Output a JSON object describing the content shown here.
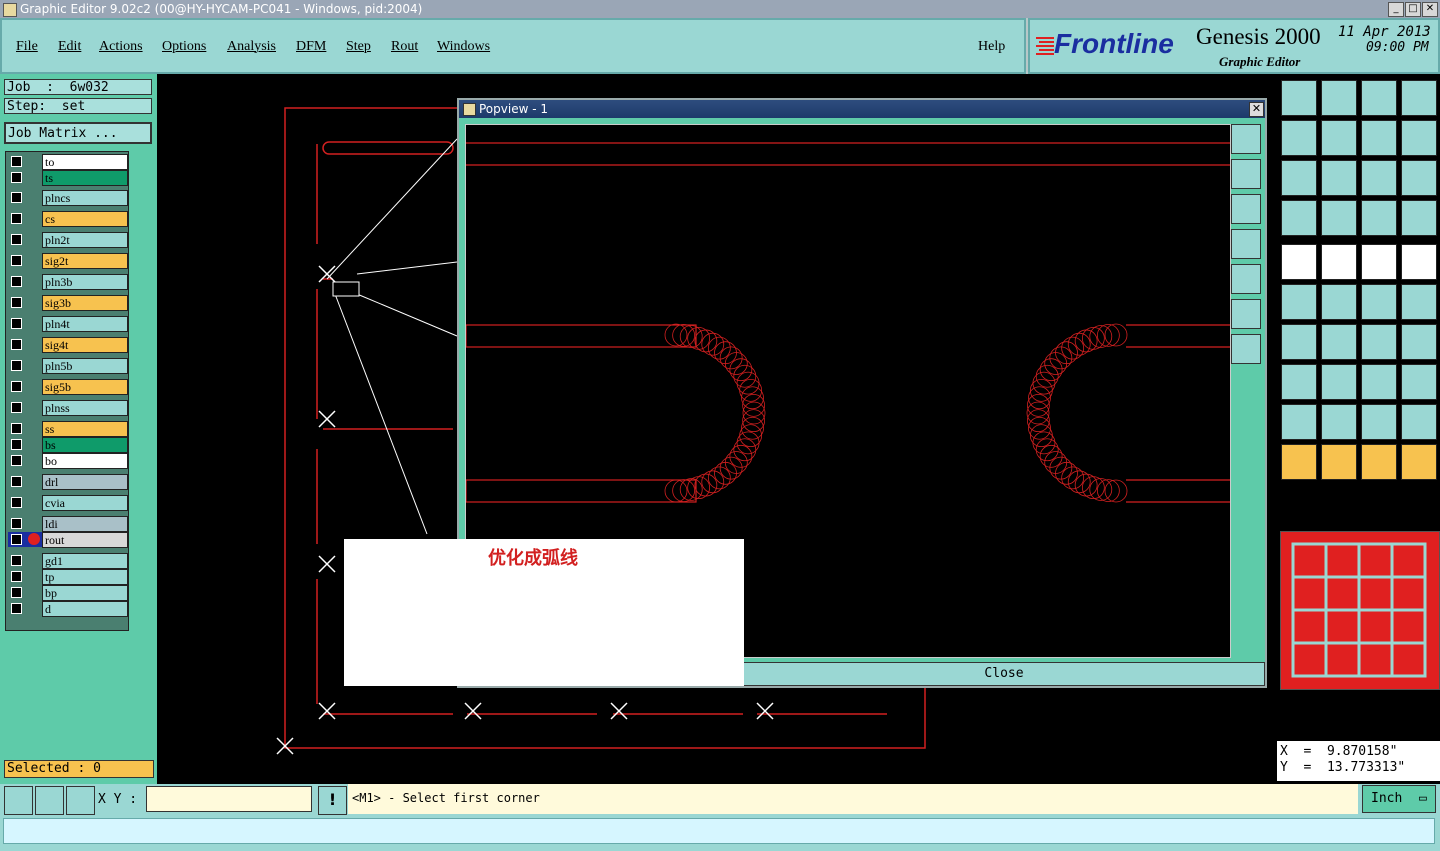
{
  "window": {
    "title": "Graphic Editor 9.02c2 (00@HY-HYCAM-PC041 - Windows, pid:2004)"
  },
  "menu": [
    "File",
    "Edit",
    "Actions",
    "Options",
    "Analysis",
    "DFM",
    "Step",
    "Rout",
    "Windows"
  ],
  "help": "Help",
  "brand": {
    "logo": "Frontline",
    "product": "Genesis 2000",
    "subtitle": "Graphic Editor",
    "date": "11 Apr 2013",
    "time": "09:00 PM"
  },
  "job": {
    "job_label": "Job  :  6w032",
    "step_label": "Step:  set",
    "matrix_button": "Job Matrix ..."
  },
  "layers": [
    {
      "name": "to",
      "color": "#ffffff"
    },
    {
      "name": "ts",
      "color": "#0f9b6a"
    },
    {
      "name": "plncs",
      "color": "#9ad7d3"
    },
    {
      "name": "cs",
      "color": "#f7c24f"
    },
    {
      "name": "pln2t",
      "color": "#9ad7d3"
    },
    {
      "name": "sig2t",
      "color": "#f7c24f"
    },
    {
      "name": "pln3b",
      "color": "#9ad7d3"
    },
    {
      "name": "sig3b",
      "color": "#f7c24f"
    },
    {
      "name": "pln4t",
      "color": "#9ad7d3"
    },
    {
      "name": "sig4t",
      "color": "#f7c24f"
    },
    {
      "name": "pln5b",
      "color": "#9ad7d3"
    },
    {
      "name": "sig5b",
      "color": "#f7c24f"
    },
    {
      "name": "plnss",
      "color": "#9ad7d3"
    },
    {
      "name": "ss",
      "color": "#f7c24f"
    },
    {
      "name": "bs",
      "color": "#0f9b6a"
    },
    {
      "name": "bo",
      "color": "#ffffff"
    },
    {
      "name": "drl",
      "color": "#a9c0c8"
    },
    {
      "name": "cvia",
      "color": "#9ad7d3"
    },
    {
      "name": "ldi",
      "color": "#a9c0c8"
    },
    {
      "name": "rout",
      "color": "#d8d8d8"
    },
    {
      "name": "gd1",
      "color": "#9ad7d3"
    },
    {
      "name": "tp",
      "color": "#9ad7d3"
    },
    {
      "name": "bp",
      "color": "#9ad7d3"
    },
    {
      "name": "d",
      "color": "#9ad7d3"
    }
  ],
  "selected": "Selected : 0",
  "popview": {
    "title": "Popview - 1",
    "close": "Close"
  },
  "annotation": "优化成弧线",
  "coords": {
    "x": "X  =  9.870158\"",
    "y": "Y  =  13.773313\""
  },
  "bottom": {
    "xy_label": "X Y :",
    "xy_value": "",
    "prompt": "<M1> - Select first corner",
    "units": "Inch"
  },
  "colors": {
    "accent": "#9ad7d3",
    "panel": "#5ecba9",
    "trace": "#d22020"
  }
}
